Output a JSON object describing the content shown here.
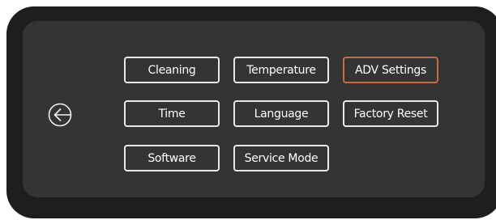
{
  "back_icon": "arrow-left-circle-icon",
  "accent_color": "#cd6a3c",
  "menu": {
    "cleaning": "Cleaning",
    "temperature": "Temperature",
    "adv_settings": "ADV Settings",
    "time": "Time",
    "language": "Language",
    "factory_reset": "Factory Reset",
    "software": "Software",
    "service_mode": "Service Mode",
    "selected": "ADV Settings"
  }
}
